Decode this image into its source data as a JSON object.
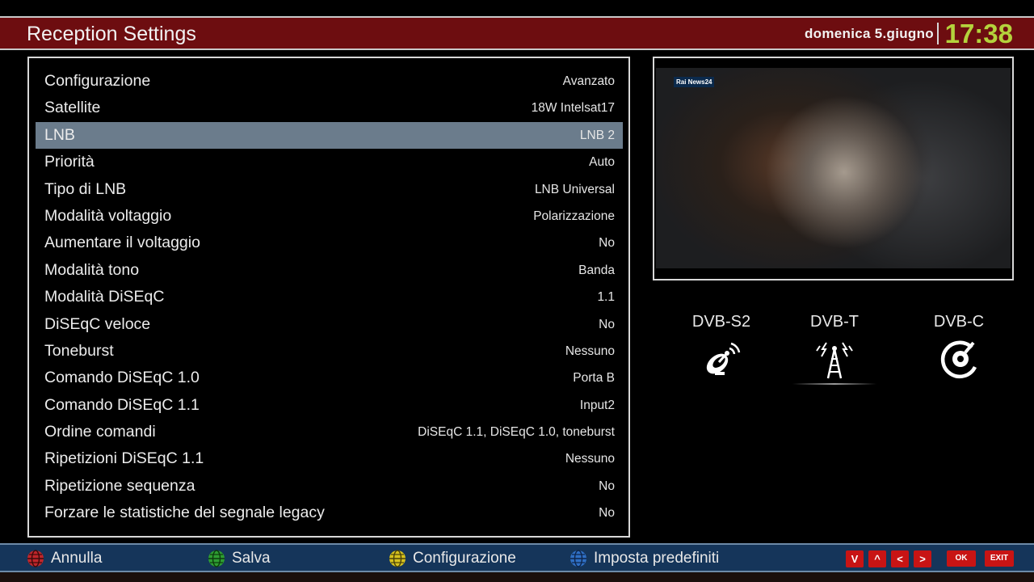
{
  "header": {
    "title": "Reception Settings",
    "date": "domenica  5.giugno",
    "time": "17:38"
  },
  "settings": [
    {
      "label": "Configurazione",
      "value": "Avanzato"
    },
    {
      "label": "Satellite",
      "value": "18W Intelsat17"
    },
    {
      "label": "LNB",
      "value": "LNB 2",
      "selected": true
    },
    {
      "label": "Priorità",
      "value": "Auto"
    },
    {
      "label": "Tipo di LNB",
      "value": "LNB Universal"
    },
    {
      "label": "Modalità voltaggio",
      "value": "Polarizzazione"
    },
    {
      "label": "Aumentare il voltaggio",
      "value": "No"
    },
    {
      "label": "Modalità tono",
      "value": "Banda"
    },
    {
      "label": "Modalità DiSEqC",
      "value": "1.1"
    },
    {
      "label": "DiSEqC veloce",
      "value": "No"
    },
    {
      "label": "Toneburst",
      "value": "Nessuno"
    },
    {
      "label": "Comando DiSEqC 1.0",
      "value": "Porta B"
    },
    {
      "label": "Comando DiSEqC 1.1",
      "value": "Input2"
    },
    {
      "label": "Ordine comandi",
      "value": "DiSEqC 1.1, DiSEqC 1.0, toneburst"
    },
    {
      "label": "Ripetizioni DiSEqC 1.1",
      "value": "Nessuno"
    },
    {
      "label": "Ripetizione sequenza",
      "value": "No"
    },
    {
      "label": "Forzare le statistiche del segnale legacy",
      "value": "No"
    }
  ],
  "preview": {
    "channel_logo": "Rai News24"
  },
  "tuners": [
    {
      "label": "DVB-S2",
      "icon": "satellite-dish-icon"
    },
    {
      "label": "DVB-T",
      "icon": "antenna-tower-icon",
      "active": true
    },
    {
      "label": "DVB-C",
      "icon": "cable-plug-icon"
    }
  ],
  "footer": {
    "buttons": [
      {
        "label": "Annulla",
        "color": "#c0262b"
      },
      {
        "label": "Salva",
        "color": "#2e9e32"
      },
      {
        "label": "Configurazione",
        "color": "#d6c21e"
      },
      {
        "label": "Imposta predefiniti",
        "color": "#2f6fc4"
      }
    ],
    "nav_keys": [
      "V",
      "^",
      "<",
      ">"
    ],
    "ok_label": "OK",
    "exit_label": "EXIT"
  },
  "colors": {
    "header_bg": "#6d0d10",
    "clock": "#b4d23c",
    "selected_row": "#6b7c8c",
    "footer_bg": "#15355a",
    "key_red": "#c81414"
  }
}
